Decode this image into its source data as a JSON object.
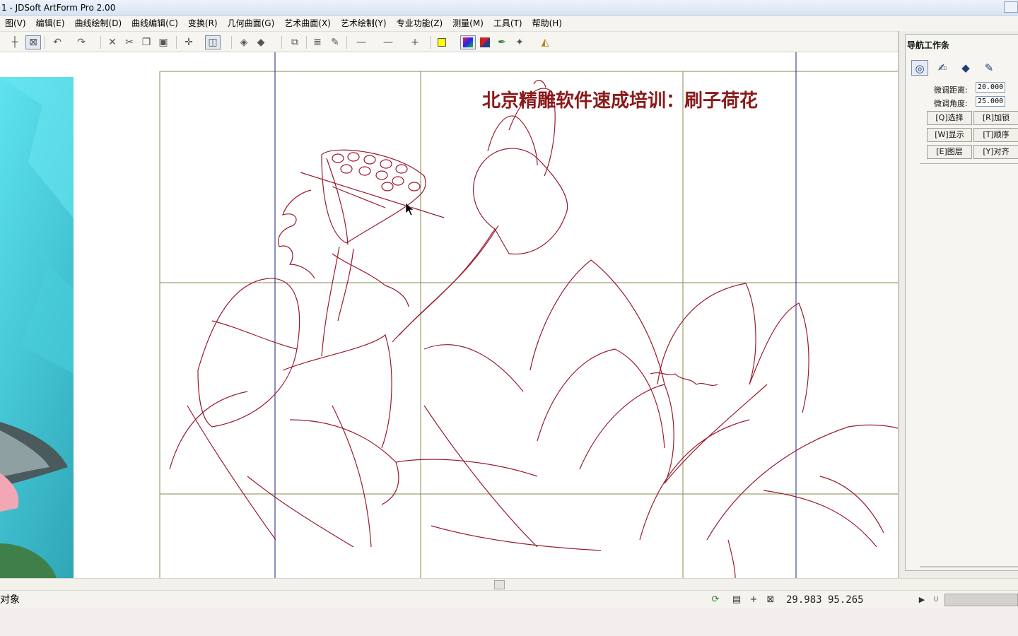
{
  "window": {
    "title": "1 - JDSoft ArtForm Pro 2.00"
  },
  "menu": [
    "图(V)",
    "编辑(E)",
    "曲线绘制(D)",
    "曲线编辑(C)",
    "变换(R)",
    "几何曲面(G)",
    "艺术曲面(X)",
    "艺术绘制(Y)",
    "专业功能(Z)",
    "测量(M)",
    "工具(T)",
    "帮助(H)"
  ],
  "toolbar_icons": [
    "snap-cross-icon",
    "select-box-icon",
    "undo-icon",
    "redo-icon",
    "delete-icon",
    "cut-icon",
    "copy-icon",
    "paste-icon",
    "move-icon",
    "mirror-icon",
    "view-3d-icon",
    "shade-icon",
    "render-icon",
    "layer-icon",
    "hatch-icon",
    "eyedropper-icon",
    "line-style-icon",
    "line-width-icon",
    "point-style-icon",
    "fill-color-icon",
    "gradient-icon",
    "color-swap-icon",
    "pen-icon",
    "spray-icon",
    "bucket-icon"
  ],
  "canvas": {
    "banner": "北京精雕软件速成培训：刷子荷花",
    "stroke_color": "#9b1b2e",
    "grid_color": "#8a8a50",
    "guide_color": "#1a237e",
    "banner_color": "#8b1a1a"
  },
  "panel": {
    "title": "导航工作条",
    "tab_icons": [
      "outline-icon",
      "pen-brush-icon",
      "eraser-icon",
      "pencil-tool-icon"
    ],
    "fine_distance_label": "微调距离:",
    "fine_distance_value": "20.000",
    "fine_angle_label": "微调角度:",
    "fine_angle_value": "25.000",
    "buttons": [
      "[Q]选择",
      "[R]加锁",
      "[W]显示",
      "[T]顺序",
      "[E]图层",
      "[Y]对齐"
    ]
  },
  "status": {
    "left_text": "对象",
    "coordinates": "29.983  95.265",
    "unit_label": "U"
  }
}
